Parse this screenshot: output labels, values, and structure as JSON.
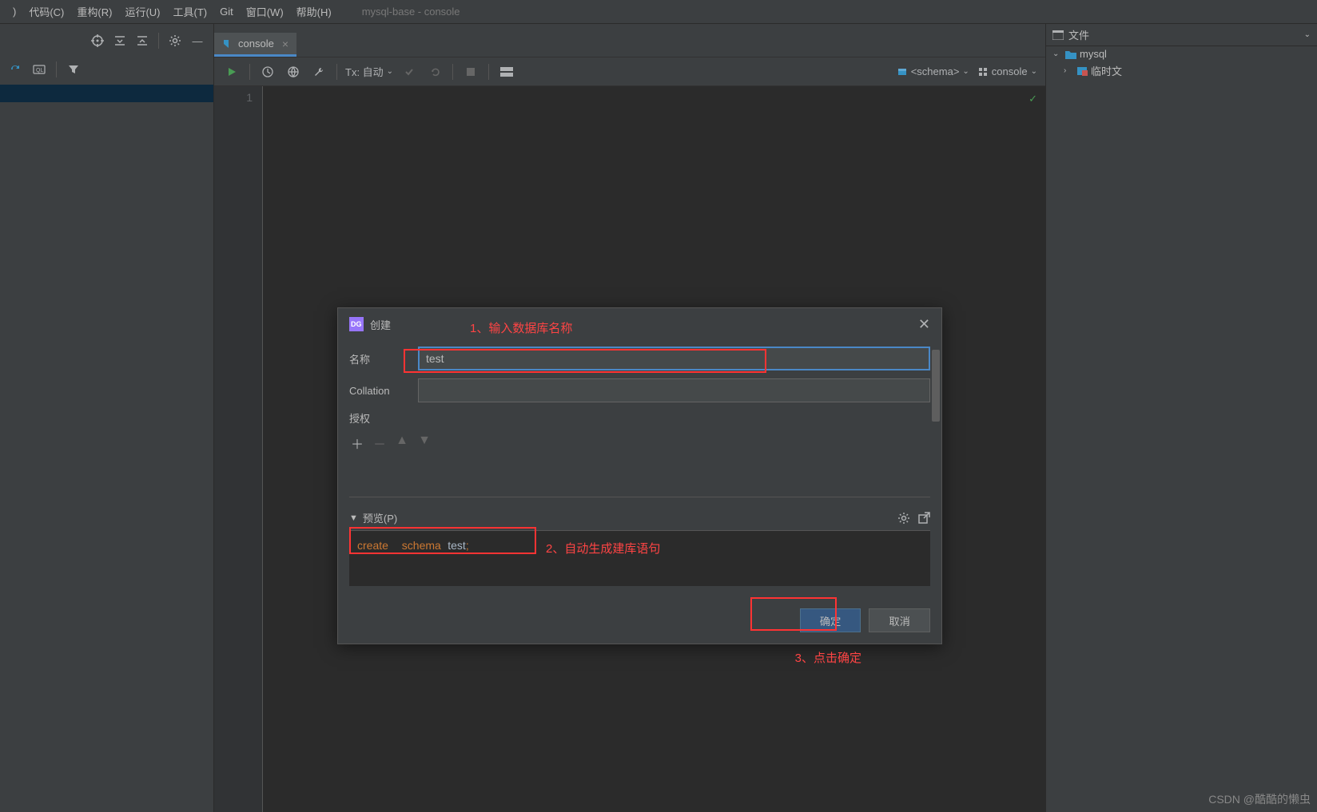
{
  "menu": {
    "code": "代码(C)",
    "refactor": "重构(R)",
    "run": "运行(U)",
    "tools": "工具(T)",
    "git": "Git",
    "window": "窗口(W)",
    "help": "帮助(H)"
  },
  "app_title": "mysql-base - console",
  "tab": {
    "label": "console"
  },
  "console_toolbar": {
    "tx": "Tx: 自动",
    "schema": "<schema>",
    "console": "console"
  },
  "editor": {
    "line_no": "1"
  },
  "right_panel": {
    "header": "文件",
    "tree": {
      "mysql": "mysql",
      "temp": "临时文"
    }
  },
  "dialog": {
    "title": "创建",
    "name_label": "名称",
    "name_value": "test",
    "collation_label": "Collation",
    "grant_label": "授权",
    "preview_label": "预览(P)",
    "sql_create": "create",
    "sql_schema": "schema",
    "sql_name": "test",
    "ok": "确定",
    "cancel": "取消"
  },
  "annotations": {
    "a1": "1、输入数据库名称",
    "a2": "2、自动生成建库语句",
    "a3": "3、点击确定"
  },
  "watermark": "CSDN @酷酷的懒虫"
}
